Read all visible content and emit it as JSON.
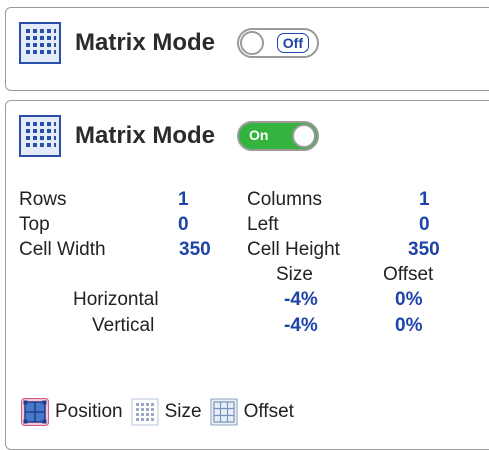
{
  "panel_off": {
    "title": "Matrix Mode",
    "toggle_label": "Off",
    "toggle_state": "off"
  },
  "panel_on": {
    "title": "Matrix Mode",
    "toggle_label": "On",
    "toggle_state": "on",
    "fields": {
      "rows_label": "Rows",
      "rows_value": "1",
      "columns_label": "Columns",
      "columns_value": "1",
      "top_label": "Top",
      "top_value": "0",
      "left_label": "Left",
      "left_value": "0",
      "cell_width_label": "Cell Width",
      "cell_width_value": "350",
      "cell_height_label": "Cell Height",
      "cell_height_value": "350"
    },
    "grid_headers": {
      "size": "Size",
      "offset": "Offset"
    },
    "horizontal": {
      "label": "Horizontal",
      "size": "-4%",
      "offset": "0%"
    },
    "vertical": {
      "label": "Vertical",
      "size": "-4%",
      "offset": "0%"
    },
    "modes": [
      {
        "label": "Position",
        "icon": "position-grid-icon",
        "selected": true
      },
      {
        "label": "Size",
        "icon": "size-grid-icon",
        "selected": false
      },
      {
        "label": "Offset",
        "icon": "offset-grid-icon",
        "selected": false
      }
    ]
  },
  "colors": {
    "accent": "#1e44a8",
    "toggle_on": "#34b33e",
    "border": "#9a9a9a",
    "selected_icon_bg": "#f6c6d8"
  }
}
